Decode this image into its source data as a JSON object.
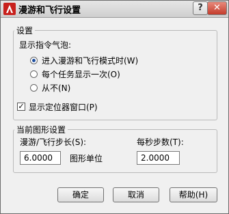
{
  "window": {
    "title": "漫游和飞行设置",
    "help_label": "?",
    "close_label": "✕"
  },
  "settings_group": {
    "title": "设置",
    "tooltip_group_title": "显示指令气泡:",
    "radio_options": [
      {
        "label": "进入漫游和飞行模式时(W)",
        "selected": true
      },
      {
        "label": "每个任务显示一次(O)",
        "selected": false
      },
      {
        "label": "从不(N)",
        "selected": false
      }
    ],
    "locator_checkbox": {
      "label": "显示定位器窗口(P)",
      "checked": true,
      "mark": "✓"
    }
  },
  "drawing_group": {
    "title": "当前图形设置",
    "step_size_label": "漫游/飞行步长(S):",
    "step_size_value": "6.0000",
    "unit_label": "图形单位",
    "steps_per_second_label": "每秒步数(T):",
    "steps_per_second_value": "2.0000"
  },
  "buttons": {
    "ok": "确定",
    "cancel": "取消",
    "help": "帮助(H)"
  }
}
